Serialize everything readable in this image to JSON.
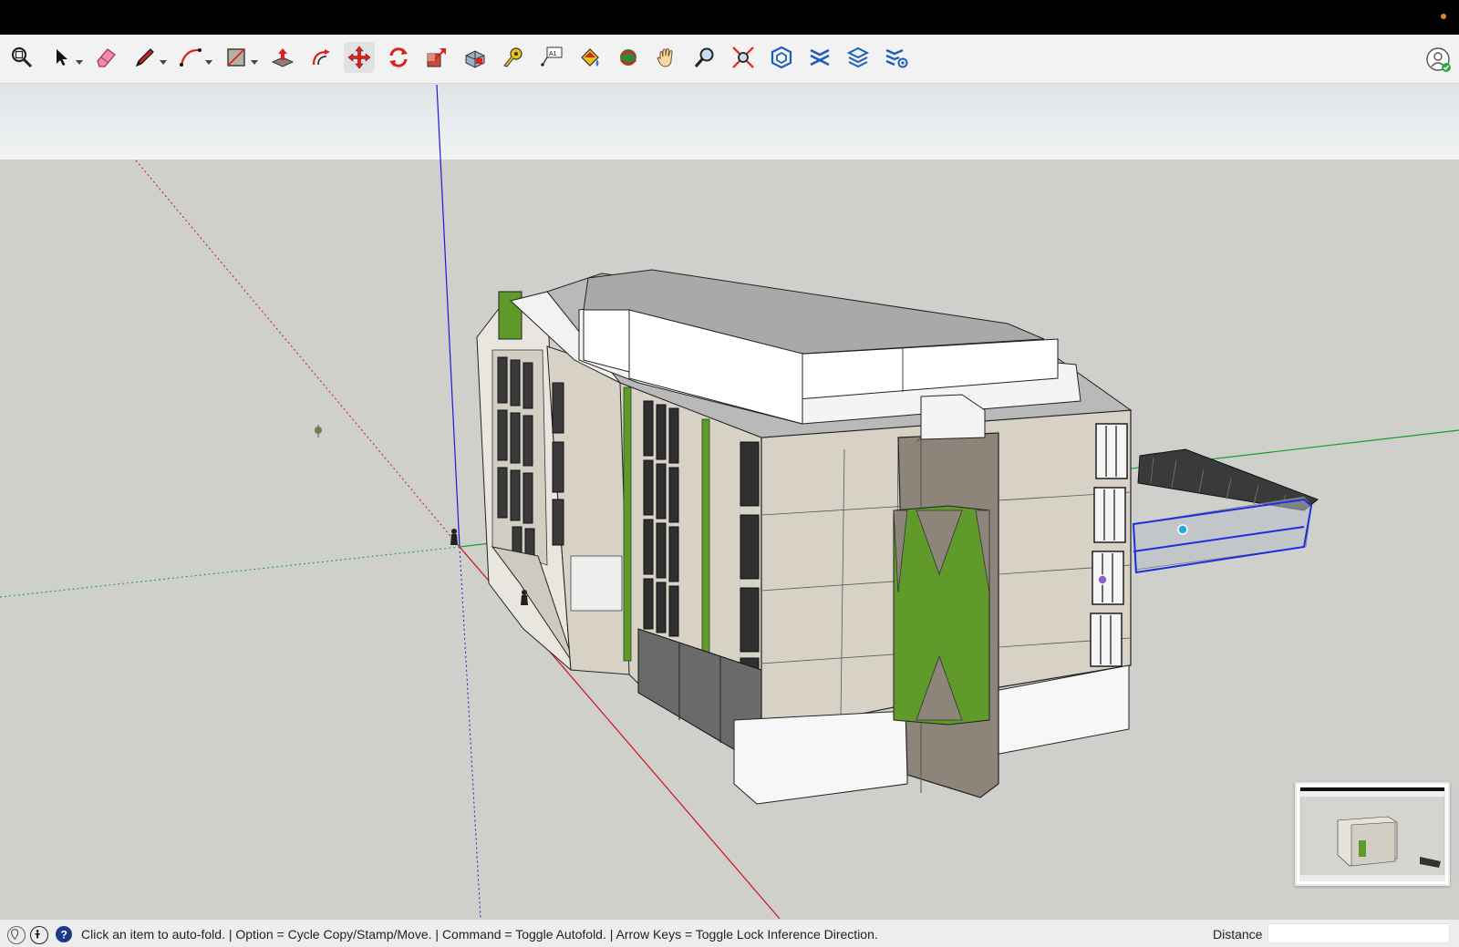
{
  "toolbar": {
    "tools": [
      {
        "name": "zoom-window-icon"
      },
      {
        "name": "select-icon",
        "has_menu": true
      },
      {
        "name": "eraser-icon"
      },
      {
        "name": "line-icon",
        "has_menu": true
      },
      {
        "name": "arc-icon",
        "has_menu": true
      },
      {
        "name": "rectangle-icon",
        "has_menu": true
      },
      {
        "name": "push-pull-icon"
      },
      {
        "name": "offset-icon"
      },
      {
        "name": "move-icon",
        "active": true
      },
      {
        "name": "rotate-icon"
      },
      {
        "name": "scale-icon"
      },
      {
        "name": "follow-me-icon"
      },
      {
        "name": "tape-measure-icon"
      },
      {
        "name": "text-icon"
      },
      {
        "name": "paint-bucket-icon"
      },
      {
        "name": "orbit-icon"
      },
      {
        "name": "pan-icon"
      },
      {
        "name": "zoom-icon"
      },
      {
        "name": "zoom-extents-icon"
      },
      {
        "name": "3d-warehouse-icon"
      },
      {
        "name": "extension-warehouse-icon"
      },
      {
        "name": "layout-icon"
      },
      {
        "name": "extension-manager-icon"
      }
    ],
    "account_icon": "account-icon"
  },
  "colors": {
    "accent_red": "#d8231f",
    "axis_red": "#d0101a",
    "axis_green": "#1a9e2a",
    "axis_blue": "#1a1adf",
    "facade_beige": "#d8d2c6",
    "living_wall_green": "#5f9a2a",
    "selection_blue": "#1b2ee0"
  },
  "status": {
    "text": "Click an item to auto-fold. | Option = Cycle Copy/Stamp/Move. | Command = Toggle Autofold. | Arrow Keys = Toggle Lock Inference Direction.",
    "icons": [
      "geolocation-icon",
      "credits-icon",
      "instructor-icon"
    ],
    "distance_label": "Distance",
    "distance_value": ""
  }
}
